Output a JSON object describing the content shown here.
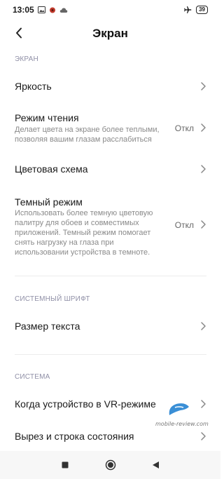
{
  "status": {
    "time": "13:05",
    "battery": "39"
  },
  "header": {
    "title": "Экран"
  },
  "sections": {
    "screen": "ЭКРАН",
    "font": "СИСТЕМНЫЙ ШРИФТ",
    "system": "СИСТЕМА"
  },
  "rows": {
    "brightness": {
      "title": "Яркость"
    },
    "reading": {
      "title": "Режим чтения",
      "desc": "Делает цвета на экране более теплыми, позволяя вашим глазам расслабиться",
      "value": "Откл"
    },
    "color_scheme": {
      "title": "Цветовая схема"
    },
    "dark": {
      "title": "Темный режим",
      "desc": "Использовать более темную цветовую палитру для обоев и совместимых приложений. Темный режим помогает снять нагрузку на глаза при использовании устройства в темноте.",
      "value": "Откл"
    },
    "text_size": {
      "title": "Размер текста"
    },
    "vr": {
      "title": "Когда устройство в VR-режиме"
    },
    "notch": {
      "title": "Вырез и строка состояния"
    }
  },
  "watermark": {
    "text": "mobile-review.com"
  },
  "colors": {
    "section_label": "#8f8fa6",
    "watermark_logo": "#3a8fd6"
  }
}
